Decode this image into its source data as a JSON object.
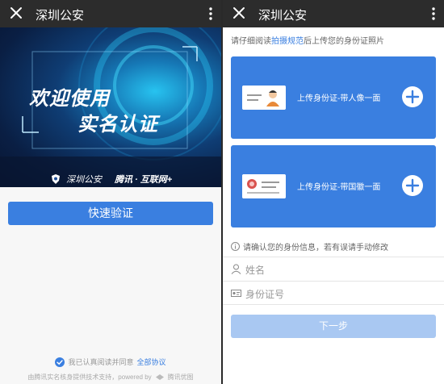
{
  "left": {
    "header": {
      "title": "深圳公安"
    },
    "banner": {
      "line1": "欢迎使用",
      "line2": "实名认证",
      "brand_police": "深圳公安",
      "brand_tencent": "腾讯 · 互联网+"
    },
    "quick_verify_label": "快速验证",
    "agreement": {
      "prefix": "我已认真阅读并同意",
      "link": "全部协议"
    },
    "powered": {
      "prefix": "由腾讯实名核身提供技术支持，powered by",
      "brand": "腾讯优图"
    }
  },
  "right": {
    "header": {
      "title": "深圳公安"
    },
    "instruction": {
      "prefix": "请仔细阅读",
      "link": "拍摄规范",
      "suffix": "后上传您的身份证照片"
    },
    "upload_front_label": "上传身份证-带人像一面",
    "upload_back_label": "上传身份证-带国徽一面",
    "info_text": "请确认您的身份信息，若有误请手动修改",
    "name_placeholder": "姓名",
    "id_placeholder": "身份证号",
    "next_label": "下一步"
  },
  "colors": {
    "accent": "#3a7fe0",
    "accent_disabled": "#a9c8f2",
    "topbar": "#2c2c2c",
    "id_photo_red": "#d9534f"
  },
  "icons": [
    "close-icon",
    "more-icon",
    "police-badge-icon",
    "check-circle-icon",
    "tencent-logo-icon",
    "id-card-portrait-icon",
    "id-card-emblem-icon",
    "plus-circle-icon",
    "info-icon",
    "person-icon",
    "id-card-icon"
  ]
}
